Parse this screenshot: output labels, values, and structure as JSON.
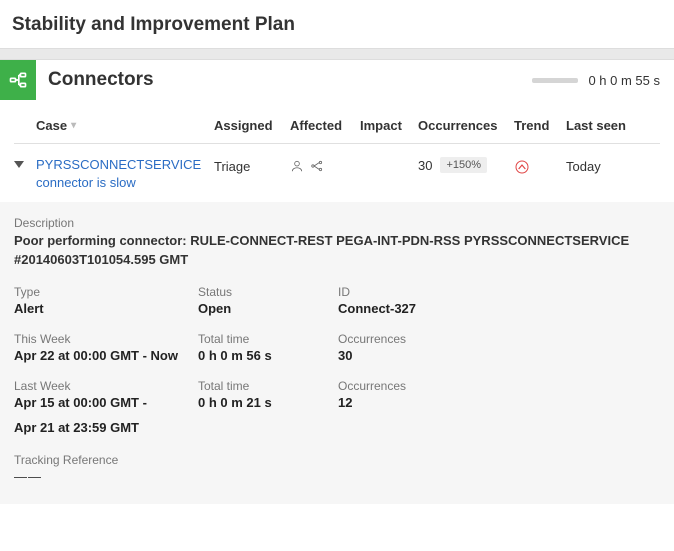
{
  "page": {
    "title": "Stability and Improvement Plan"
  },
  "section": {
    "title": "Connectors",
    "time": "0 h 0 m 55 s"
  },
  "columns": {
    "case": "Case",
    "assigned": "Assigned",
    "affected": "Affected",
    "impact": "Impact",
    "occurrences": "Occurrences",
    "trend": "Trend",
    "lastseen": "Last seen"
  },
  "row": {
    "case_line1": "PYRSSCONNECTSERVICE",
    "case_line2": "connector is slow",
    "assigned": "Triage",
    "occurrences": "30",
    "trend_badge": "+150%",
    "lastseen": "Today"
  },
  "details": {
    "desc_label": "Description",
    "desc_value": "Poor performing connector: RULE-CONNECT-REST PEGA-INT-PDN-RSS PYRSSCONNECTSERVICE #20140603T101054.595 GMT",
    "type_label": "Type",
    "type_value": "Alert",
    "status_label": "Status",
    "status_value": "Open",
    "id_label": "ID",
    "id_value": "Connect-327",
    "thisweek_label": "This Week",
    "thisweek_value": "Apr 22 at 00:00 GMT  - Now",
    "tw_total_label": "Total time",
    "tw_total_value": "0 h 0 m 56 s",
    "tw_occ_label": "Occurrences",
    "tw_occ_value": "30",
    "lastweek_label": "Last Week",
    "lastweek_value": "Apr 15 at 00:00 GMT  -",
    "lw_total_label": "Total time",
    "lw_total_value": "0 h 0 m 21 s",
    "lw_occ_label": "Occurrences",
    "lw_occ_value": "12",
    "lw_end": "Apr 21 at 23:59 GMT",
    "tracking_label": "Tracking Reference",
    "tracking_value": "——"
  }
}
